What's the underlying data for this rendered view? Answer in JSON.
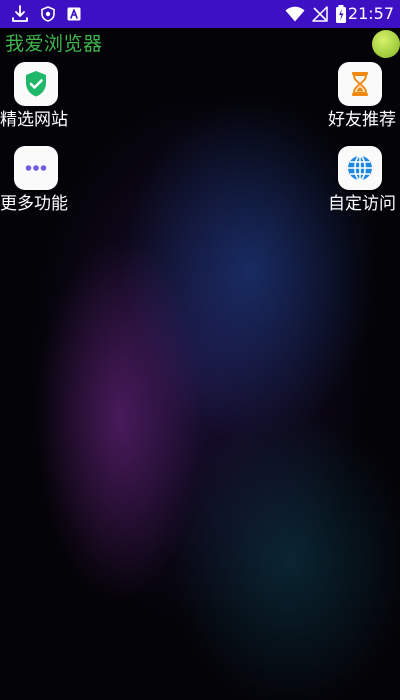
{
  "status_bar": {
    "time": "21:57",
    "color": "#3d10c4",
    "left_icons": [
      "download-icon",
      "shield-icon",
      "font-a-icon"
    ],
    "right_icons": [
      "wifi-icon",
      "no-signal-icon",
      "battery-icon"
    ]
  },
  "app": {
    "title": "我爱浏览器",
    "title_color": "#3fb54a"
  },
  "tiles": [
    {
      "label": "精选网站",
      "icon": "shield-check-icon"
    },
    {
      "label": "好友推荐",
      "icon": "hourglass-icon"
    },
    {
      "label": "更多功能",
      "icon": "more-dots-icon"
    },
    {
      "label": "自定访问",
      "icon": "globe-icon"
    }
  ]
}
